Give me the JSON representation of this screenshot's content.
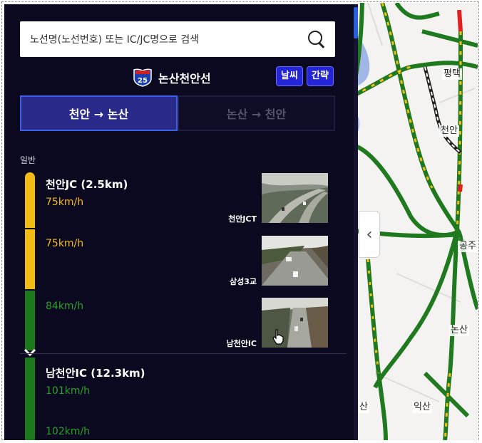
{
  "search": {
    "placeholder": "노선명(노선번호) 또는 IC/JC명으로 검색"
  },
  "route": {
    "number": "25",
    "name": "논산천안선"
  },
  "buttons": {
    "weather": "날씨",
    "summary": "간략"
  },
  "direction_tabs": [
    {
      "label": "천안 → 논산",
      "active": true
    },
    {
      "label": "논산 → 천안",
      "active": false
    }
  ],
  "section": {
    "label": "일반"
  },
  "segments": [
    {
      "ic": "천안JC (2.5km)",
      "speeds": [
        "75km/h",
        "75km/h",
        "84km/h"
      ]
    },
    {
      "ic": "남천안IC (12.3km)",
      "speeds": [
        "101km/h",
        "102km/h"
      ]
    }
  ],
  "cctv": [
    {
      "label": "천안JCT"
    },
    {
      "label": "삼성3교"
    },
    {
      "label": "남천안IC"
    }
  ],
  "map": {
    "labels": [
      "평택",
      "천안",
      "공주",
      "논산",
      "익산",
      "산",
      "산"
    ]
  },
  "colors": {
    "panel_bg": "#0b0920",
    "accent": "#2424d8",
    "slow": "#f2bc14",
    "free": "#2aa02a"
  }
}
